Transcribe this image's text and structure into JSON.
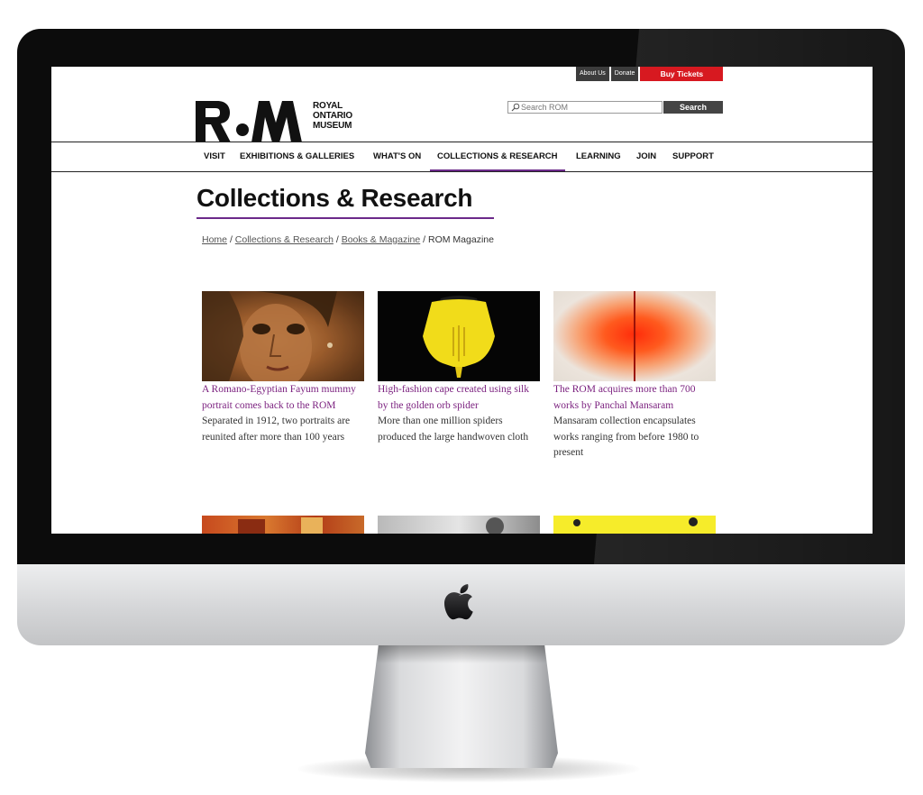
{
  "utility_nav": {
    "about": "About Us",
    "donate": "Donate",
    "buy_tickets": "Buy Tickets"
  },
  "logo": {
    "line1": "ROYAL",
    "line2": "ONTARIO",
    "line3": "MUSEUM"
  },
  "search": {
    "placeholder": "Search ROM",
    "button": "Search"
  },
  "main_nav": [
    {
      "label": "Visit"
    },
    {
      "label": "Exhibitions & Galleries"
    },
    {
      "label": "What's On"
    },
    {
      "label": "Collections & Research",
      "active": true
    },
    {
      "label": "Learning"
    },
    {
      "label": "Join"
    },
    {
      "label": "Support"
    }
  ],
  "page": {
    "title": "Collections & Research"
  },
  "breadcrumb": {
    "items": [
      "Home",
      "Collections & Research",
      "Books & Magazine"
    ],
    "current": "ROM Magazine"
  },
  "articles": [
    {
      "title": "A Romano-Egyptian Fayum mummy portrait comes back to the ROM",
      "description": "Separated in 1912, two portraits are reunited after more than 100 years"
    },
    {
      "title": "High-fashion cape created using silk by the golden orb spider",
      "description": "More than one million spiders produced the large handwoven cloth"
    },
    {
      "title": "The ROM acquires more than 700 works by Panchal Mansaram",
      "description": "Mansaram collection encapsulates works ranging from before 1980 to present"
    }
  ],
  "colors": {
    "accent_purple": "#6b2a8a",
    "link_purple": "#7a1f7e",
    "buy_red": "#d71920",
    "utility_gray": "#3c3c3c"
  }
}
